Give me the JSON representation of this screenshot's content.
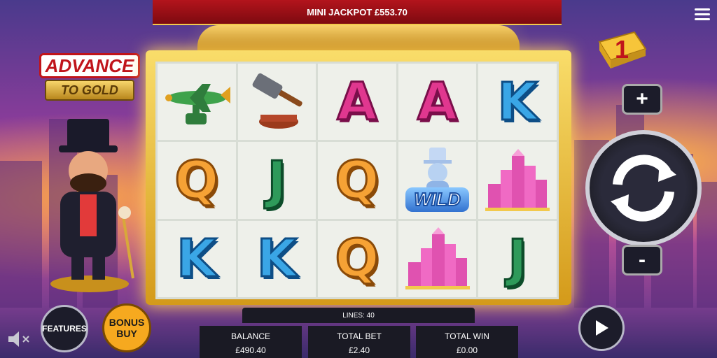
{
  "jackpot": {
    "label": "MINI JACKPOT £553.70"
  },
  "logo": {
    "line1": "ADVANCE",
    "line2": "TO GOLD"
  },
  "reels": [
    [
      "plane",
      "gavel",
      "A",
      "A",
      "K"
    ],
    [
      "Q",
      "J",
      "Q",
      "wild",
      "buildings"
    ],
    [
      "K",
      "K",
      "Q",
      "buildings",
      "J"
    ]
  ],
  "wild_label": "WILD",
  "bet_level": "1",
  "controls": {
    "features": "FEATURES",
    "bonus_line1": "BONUS",
    "bonus_line2": "BUY",
    "plus": "+",
    "minus": "-"
  },
  "lines": "LINES: 40",
  "stats": {
    "balance_label": "BALANCE",
    "balance_value": "£490.40",
    "bet_label": "TOTAL BET",
    "bet_value": "£2.40",
    "win_label": "TOTAL WIN",
    "win_value": "£0.00"
  },
  "colors": {
    "jackpot_bg": "#b3141c",
    "frame_gold": "#f9dd6a",
    "panel_dark": "#1a1a24"
  }
}
